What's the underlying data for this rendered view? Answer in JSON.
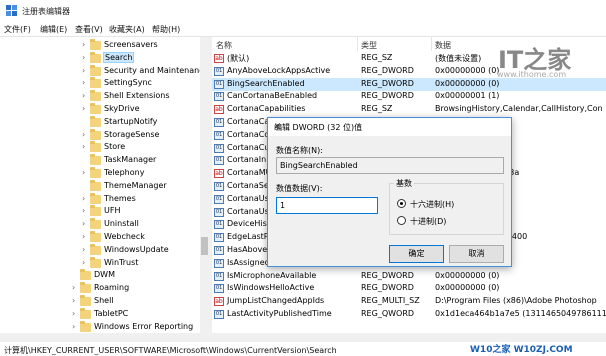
{
  "window": {
    "title": "注册表编辑器"
  },
  "menu": [
    "文件(F)",
    "编辑(E)",
    "查看(V)",
    "收藏夹(A)",
    "帮助(H)"
  ],
  "tree": [
    {
      "label": "Screensavers",
      "indent": 1,
      "expander": "›"
    },
    {
      "label": "Search",
      "indent": 1,
      "expander": "›",
      "selected": true
    },
    {
      "label": "Security and Maintenance",
      "indent": 1,
      "expander": "›"
    },
    {
      "label": "SettingSync",
      "indent": 1,
      "expander": "›"
    },
    {
      "label": "Shell Extensions",
      "indent": 1,
      "expander": "›"
    },
    {
      "label": "SkyDrive",
      "indent": 1,
      "expander": "›"
    },
    {
      "label": "StartupNotify",
      "indent": 1,
      "expander": ""
    },
    {
      "label": "StorageSense",
      "indent": 1,
      "expander": "›"
    },
    {
      "label": "Store",
      "indent": 1,
      "expander": "›"
    },
    {
      "label": "TaskManager",
      "indent": 1,
      "expander": ""
    },
    {
      "label": "Telephony",
      "indent": 1,
      "expander": "›"
    },
    {
      "label": "ThemeManager",
      "indent": 1,
      "expander": ""
    },
    {
      "label": "Themes",
      "indent": 1,
      "expander": "›"
    },
    {
      "label": "UFH",
      "indent": 1,
      "expander": "›"
    },
    {
      "label": "Uninstall",
      "indent": 1,
      "expander": "›"
    },
    {
      "label": "Webcheck",
      "indent": 1,
      "expander": "›"
    },
    {
      "label": "WindowsUpdate",
      "indent": 1,
      "expander": "›"
    },
    {
      "label": "WinTrust",
      "indent": 1,
      "expander": "›"
    },
    {
      "label": "DWM",
      "indent": 0,
      "expander": ""
    },
    {
      "label": "Roaming",
      "indent": 0,
      "expander": "›"
    },
    {
      "label": "Shell",
      "indent": 0,
      "expander": "›"
    },
    {
      "label": "TabletPC",
      "indent": 0,
      "expander": "›"
    },
    {
      "label": "Windows Error Reporting",
      "indent": 0,
      "expander": "›"
    }
  ],
  "list": {
    "headers": {
      "name": "名称",
      "type": "类型",
      "data": "数据"
    },
    "rows": [
      {
        "icon": "ab",
        "name": "(默认)",
        "type": "REG_SZ",
        "data": "(数值未设置)"
      },
      {
        "icon": "bin",
        "name": "AnyAboveLockAppsActive",
        "type": "REG_DWORD",
        "data": "0x00000000 (0)"
      },
      {
        "icon": "bin",
        "name": "BingSearchEnabled",
        "type": "REG_DWORD",
        "data": "0x00000000 (0)",
        "selected": true
      },
      {
        "icon": "bin",
        "name": "CanCortanaBeEnabled",
        "type": "REG_DWORD",
        "data": "0x00000001 (1)"
      },
      {
        "icon": "ab",
        "name": "CortanaCapabilities",
        "type": "REG_SZ",
        "data": "BrowsingHistory,Calendar,CallHistory,Con"
      },
      {
        "icon": "bin",
        "name": "CortanaCa",
        "type": "",
        "data": ""
      },
      {
        "icon": "bin",
        "name": "CortanaCo",
        "type": "",
        "data": ""
      },
      {
        "icon": "bin",
        "name": "CortanaCu",
        "type": "",
        "data": ""
      },
      {
        "icon": "bin",
        "name": "CortanaIn",
        "type": "",
        "data": ""
      },
      {
        "icon": "ab",
        "name": "CortanaMU",
        "type": "",
        "data": "74b008af239ff6863a"
      },
      {
        "icon": "bin",
        "name": "CortanaSe",
        "type": "",
        "data": ""
      },
      {
        "icon": "bin",
        "name": "CortanaUs",
        "type": "",
        "data": ""
      },
      {
        "icon": "bin",
        "name": "CortanaUs",
        "type": "",
        "data": ""
      },
      {
        "icon": "bin",
        "name": "DeviceHist",
        "type": "",
        "data": ""
      },
      {
        "icon": "bin",
        "name": "EdgeLastP",
        "type": "",
        "data": "0 (1311463429786400"
      },
      {
        "icon": "bin",
        "name": "HasAboveL",
        "type": "",
        "data": ""
      },
      {
        "icon": "bin",
        "name": "IsAssigned",
        "type": "",
        "data": ""
      },
      {
        "icon": "bin",
        "name": "IsMicrophoneAvailable",
        "type": "REG_DWORD",
        "data": "0x00000000 (0)"
      },
      {
        "icon": "bin",
        "name": "IsWindowsHelloActive",
        "type": "REG_DWORD",
        "data": "0x00000000 (0)"
      },
      {
        "icon": "ab",
        "name": "JumpListChangedAppIds",
        "type": "REG_MULTI_SZ",
        "data": "D:\\Program Files (x86)\\Adobe Photoshop"
      },
      {
        "icon": "bin",
        "name": "LastActivityPublishedTime",
        "type": "REG_QWORD",
        "data": "0x1d1eca464b1a7e5 (1311465049786111"
      }
    ]
  },
  "statusbar": {
    "path": "计算机\\HKEY_CURRENT_USER\\SOFTWARE\\Microsoft\\Windows\\CurrentVersion\\Search"
  },
  "watermark": {
    "logo": "IT之家",
    "url": "www.ithome.com",
    "bottom": "W10之家 W10ZJ.COM"
  },
  "dialog": {
    "title": "编辑 DWORD (32 位)值",
    "name_label": "数值名称(N):",
    "name_value": "BingSearchEnabled",
    "data_label": "数值数据(V):",
    "data_value": "1",
    "base_label": "基数",
    "hex_label": "十六进制(H)",
    "dec_label": "十进制(D)",
    "ok_label": "确定",
    "cancel_label": "取消",
    "close_glyph": "✕"
  }
}
